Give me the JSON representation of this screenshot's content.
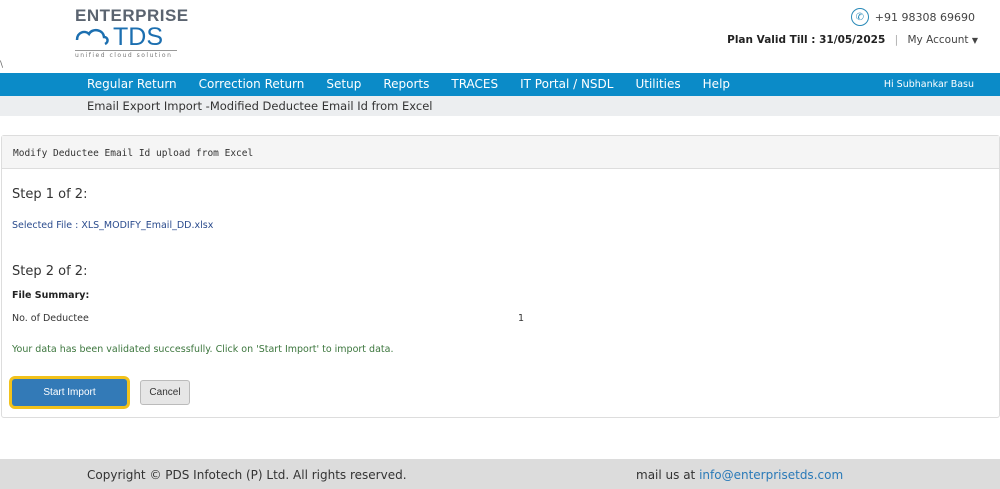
{
  "logo": {
    "line1": "ENTERPRISE",
    "line2": "TDS",
    "tagline": "unified cloud solution"
  },
  "header": {
    "phone": "+91 98308 69690",
    "plan": "Plan Valid Till : 31/05/2025",
    "separator": "|",
    "account": "My Account"
  },
  "nav": {
    "items": [
      "Regular Return",
      "Correction Return",
      "Setup",
      "Reports",
      "TRACES",
      "IT Portal / NSDL",
      "Utilities",
      "Help"
    ],
    "greeting": "Hi Subhankar Basu"
  },
  "breadcrumb": "Email Export Import -Modified Deductee Email Id from Excel",
  "panel": {
    "title": "Modify Deductee Email Id upload from Excel",
    "step1": "Step 1 of 2:",
    "selected_file": "Selected File : XLS_MODIFY_Email_DD.xlsx",
    "step2": "Step 2 of 2:",
    "summary_label": "File Summary:",
    "deductee_label": "No. of Deductee",
    "deductee_count": "1",
    "success_msg": "Your data has been validated successfully. Click on 'Start Import' to import data.",
    "start_button": "Start Import",
    "cancel_button": "Cancel"
  },
  "footer": {
    "copyright": "Copyright © PDS Infotech (P) Ltd. All rights reserved.",
    "mail_prefix": "mail us at ",
    "mail": "info@enterprisetds.com"
  },
  "colors": {
    "nav": "#0b8bc8",
    "button": "#337ab7",
    "highlight": "#f2c21b",
    "success": "#3c763d"
  }
}
